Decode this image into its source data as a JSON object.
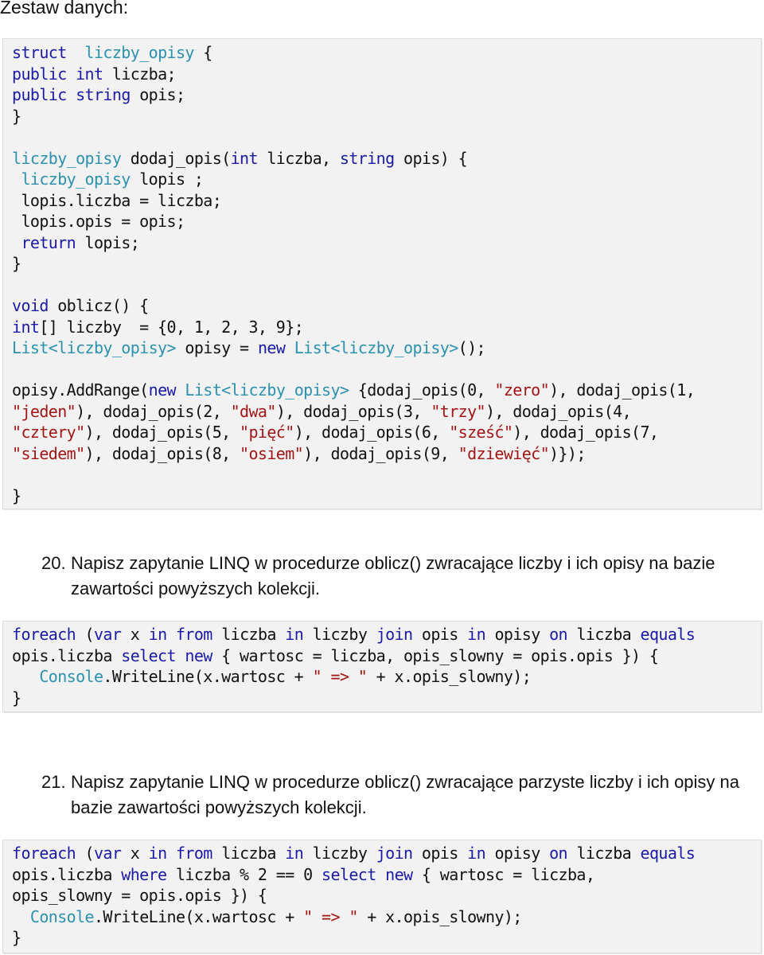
{
  "heading": "Zestaw danych:",
  "dataset_code": [
    [
      [
        "kw",
        "struct"
      ],
      [
        "",
        "  "
      ],
      [
        "ty",
        "liczby_opisy"
      ],
      [
        "",
        " {"
      ]
    ],
    [
      [
        "kw",
        "public"
      ],
      [
        "",
        " "
      ],
      [
        "kw",
        "int"
      ],
      [
        "",
        " liczba;"
      ]
    ],
    [
      [
        "kw",
        "public"
      ],
      [
        "",
        " "
      ],
      [
        "kw",
        "string"
      ],
      [
        "",
        " opis;"
      ]
    ],
    [
      [
        "",
        "}"
      ]
    ],
    [
      [
        "",
        ""
      ]
    ],
    [
      [
        "ty",
        "liczby_opisy"
      ],
      [
        "",
        " dodaj_opis("
      ],
      [
        "kw",
        "int"
      ],
      [
        "",
        " liczba, "
      ],
      [
        "kw",
        "string"
      ],
      [
        "",
        " opis) {"
      ]
    ],
    [
      [
        "",
        " "
      ],
      [
        "ty",
        "liczby_opisy"
      ],
      [
        "",
        " lopis ;"
      ]
    ],
    [
      [
        "",
        " lopis.liczba = liczba;"
      ]
    ],
    [
      [
        "",
        " lopis.opis = opis;"
      ]
    ],
    [
      [
        "",
        " "
      ],
      [
        "kw",
        "return"
      ],
      [
        "",
        " lopis;"
      ]
    ],
    [
      [
        "",
        "}"
      ]
    ],
    [
      [
        "",
        ""
      ]
    ],
    [
      [
        "kw",
        "void"
      ],
      [
        "",
        " oblicz() {"
      ]
    ],
    [
      [
        "kw",
        "int"
      ],
      [
        "",
        "[] liczby  = {0, 1, 2, 3, 9};"
      ]
    ],
    [
      [
        "ty",
        "List"
      ],
      [
        "ty",
        "<liczby_opisy>"
      ],
      [
        "",
        " opisy = "
      ],
      [
        "kw",
        "new"
      ],
      [
        "",
        " "
      ],
      [
        "ty",
        "List<liczby_opisy>"
      ],
      [
        "",
        "();"
      ]
    ],
    [
      [
        "",
        ""
      ]
    ],
    [
      [
        "",
        "opisy.AddRange("
      ],
      [
        "kw",
        "new"
      ],
      [
        "",
        " "
      ],
      [
        "ty",
        "List<liczby_opisy>"
      ],
      [
        "",
        " {dodaj_opis(0, "
      ],
      [
        "st",
        "\"zero\""
      ],
      [
        "",
        "), dodaj_opis(1,"
      ]
    ],
    [
      [
        "st",
        "\"jeden\""
      ],
      [
        "",
        "), dodaj_opis(2, "
      ],
      [
        "st",
        "\"dwa\""
      ],
      [
        "",
        "), dodaj_opis(3, "
      ],
      [
        "st",
        "\"trzy\""
      ],
      [
        "",
        "), dodaj_opis(4,"
      ]
    ],
    [
      [
        "st",
        "\"cztery\""
      ],
      [
        "",
        "), dodaj_opis(5, "
      ],
      [
        "st",
        "\"pięć\""
      ],
      [
        "",
        "), dodaj_opis(6, "
      ],
      [
        "st",
        "\"sześć\""
      ],
      [
        "",
        "), dodaj_opis(7,"
      ]
    ],
    [
      [
        "st",
        "\"siedem\""
      ],
      [
        "",
        "), dodaj_opis(8, "
      ],
      [
        "st",
        "\"osiem\""
      ],
      [
        "",
        "), dodaj_opis(9, "
      ],
      [
        "st",
        "\"dziewięć\""
      ],
      [
        "",
        "​)});"
      ]
    ],
    [
      [
        "",
        ""
      ]
    ],
    [
      [
        "",
        "}"
      ]
    ]
  ],
  "tasks": [
    {
      "number": "20.",
      "text": "Napisz zapytanie LINQ w procedurze oblicz() zwracające liczby i ich opisy na bazie zawartości powyższych kolekcji.",
      "code": [
        [
          [
            "kw",
            "foreach"
          ],
          [
            "",
            " ("
          ],
          [
            "kw",
            "var"
          ],
          [
            "",
            " x "
          ],
          [
            "kw",
            "in"
          ],
          [
            "",
            " "
          ],
          [
            "kw",
            "from"
          ],
          [
            "",
            " liczba "
          ],
          [
            "kw",
            "in"
          ],
          [
            "",
            " liczby "
          ],
          [
            "kw",
            "join"
          ],
          [
            "",
            " opis "
          ],
          [
            "kw",
            "in"
          ],
          [
            "",
            " opisy "
          ],
          [
            "kw",
            "on"
          ],
          [
            "",
            " liczba "
          ],
          [
            "kw",
            "equals"
          ]
        ],
        [
          [
            "",
            "opis.liczba "
          ],
          [
            "kw",
            "select"
          ],
          [
            "",
            " "
          ],
          [
            "kw",
            "new"
          ],
          [
            "",
            " { wartosc = liczba, opis_slowny = opis.opis }) {"
          ]
        ],
        [
          [
            "",
            "   "
          ],
          [
            "ty",
            "Console"
          ],
          [
            "",
            ".WriteLine(x.wartosc + "
          ],
          [
            "st",
            "\" => \""
          ],
          [
            "",
            " + x.opis_slowny);"
          ]
        ],
        [
          [
            "",
            "}"
          ]
        ]
      ]
    },
    {
      "number": "21.",
      "text": "Napisz zapytanie LINQ w procedurze oblicz() zwracające parzyste liczby i ich opisy na bazie zawartości powyższych kolekcji.",
      "code": [
        [
          [
            "kw",
            "foreach"
          ],
          [
            "",
            " ("
          ],
          [
            "kw",
            "var"
          ],
          [
            "",
            " x "
          ],
          [
            "kw",
            "in"
          ],
          [
            "",
            " "
          ],
          [
            "kw",
            "from"
          ],
          [
            "",
            " liczba "
          ],
          [
            "kw",
            "in"
          ],
          [
            "",
            " liczby "
          ],
          [
            "kw",
            "join"
          ],
          [
            "",
            " opis "
          ],
          [
            "kw",
            "in"
          ],
          [
            "",
            " opisy "
          ],
          [
            "kw",
            "on"
          ],
          [
            "",
            " liczba "
          ],
          [
            "kw",
            "equals"
          ]
        ],
        [
          [
            "",
            "opis.liczba "
          ],
          [
            "kw",
            "where"
          ],
          [
            "",
            " liczba % 2 == 0 "
          ],
          [
            "kw",
            "select"
          ],
          [
            "",
            " "
          ],
          [
            "kw",
            "new"
          ],
          [
            "",
            " { wartosc = liczba,"
          ]
        ],
        [
          [
            "",
            "opis_slowny = opis.opis }) {"
          ]
        ],
        [
          [
            "",
            "  "
          ],
          [
            "ty",
            "Console"
          ],
          [
            "",
            ".WriteLine(x.wartosc + "
          ],
          [
            "st",
            "\" => \""
          ],
          [
            "",
            " + x.opis_slowny);"
          ]
        ],
        [
          [
            "",
            "}"
          ]
        ]
      ]
    }
  ]
}
